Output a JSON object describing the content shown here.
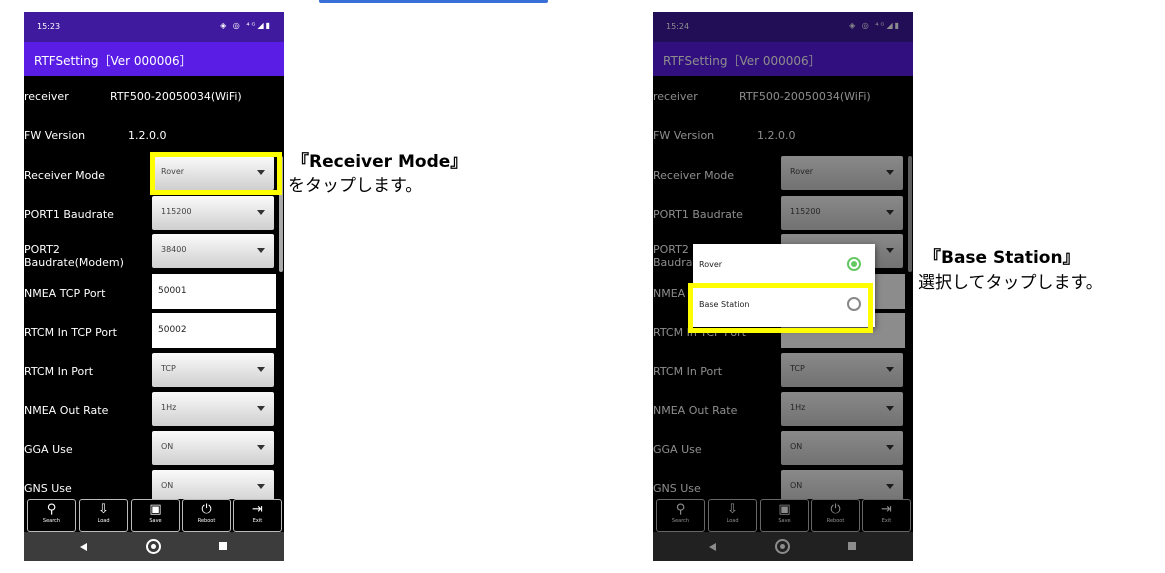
{
  "top_tab": {
    "color": "#3a6fd8"
  },
  "left": {
    "status_time": "15:23",
    "app_title": "RTFSetting［Ver 000006］",
    "receiver_label": "receiver",
    "receiver_value": "RTF500-20050034(WiFi)",
    "fw_label": "FW Version",
    "fw_value": "1.2.0.0",
    "fields": [
      {
        "label": "Receiver Mode",
        "value": "Rover"
      },
      {
        "label": "PORT1 Baudrate",
        "value": "115200"
      },
      {
        "label": "PORT2\nBaudrate(Modem)",
        "value": "38400"
      },
      {
        "label": "NMEA TCP Port",
        "value": "50001"
      },
      {
        "label": "RTCM In TCP Port",
        "value": "50002"
      },
      {
        "label": "RTCM In Port",
        "value": "TCP"
      },
      {
        "label": "NMEA Out Rate",
        "value": "1Hz"
      },
      {
        "label": "GGA Use",
        "value": "ON"
      },
      {
        "label": "GNS Use",
        "value": "ON"
      }
    ]
  },
  "right": {
    "status_time": "15:24",
    "app_title": "RTFSetting［Ver 000006］",
    "receiver_label": "receiver",
    "receiver_value": "RTF500-20050034(WiFi)",
    "fw_label": "FW Version",
    "fw_value": "1.2.0.0",
    "fields": [
      {
        "label": "Receiver Mode",
        "value": "Rover"
      },
      {
        "label": "PORT1 Baudrate",
        "value": "115200"
      },
      {
        "label": "PORT2\nBaudrat",
        "value": ""
      },
      {
        "label": "NMEA",
        "value": ""
      },
      {
        "label": "RTCM In TCP Port",
        "value": ""
      },
      {
        "label": "RTCM In Port",
        "value": "TCP"
      },
      {
        "label": "NMEA Out Rate",
        "value": "1Hz"
      },
      {
        "label": "GGA Use",
        "value": "ON"
      },
      {
        "label": "GNS Use",
        "value": "ON"
      }
    ],
    "dialog": {
      "options": [
        {
          "label": "Rover",
          "selected": true
        },
        {
          "label": "Base Station",
          "selected": false
        }
      ]
    }
  },
  "toolbar": [
    "Search",
    "Load",
    "Save",
    "Reboot",
    "Exit"
  ],
  "annotations": {
    "left_title": "『Receiver Mode』",
    "left_text": "をタップします。",
    "right_title": "『Base Station』",
    "right_text": "選択してタップします。"
  },
  "colors": {
    "status_bar": "#3f1a9e",
    "app_bar": "#5a1de6",
    "highlight": "#ffff00",
    "radio_selected": "#64c864"
  }
}
